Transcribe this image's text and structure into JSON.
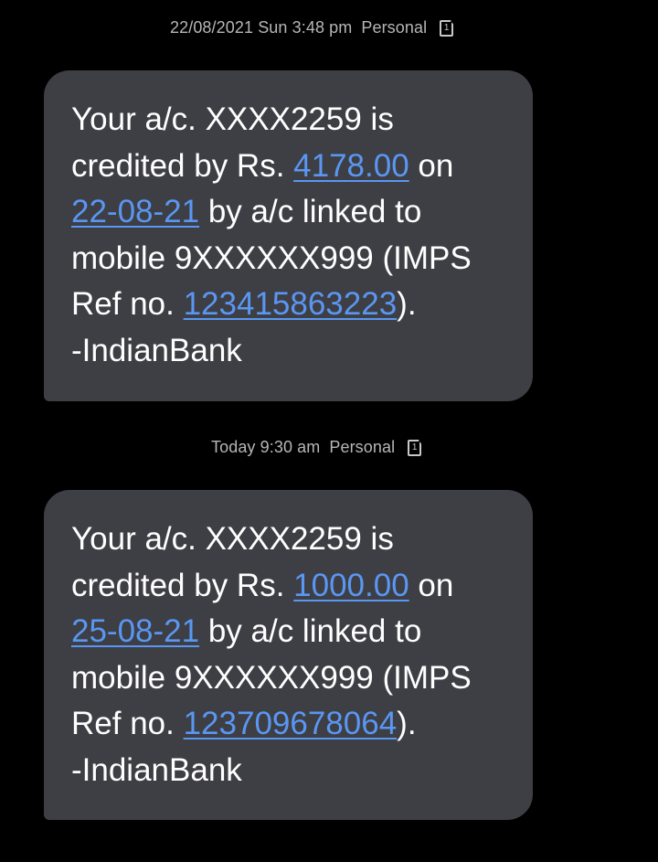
{
  "messages": [
    {
      "meta": {
        "timestamp": "22/08/2021 Sun 3:48 pm",
        "category": "Personal",
        "sim_label": "1"
      },
      "line1": "Your a/c. XXXX2259 is",
      "line2_prefix": "credited by Rs. ",
      "amount": "4178.00",
      "line2_suffix": " on",
      "date": "22-08-21",
      "line3_suffix": " by a/c linked to",
      "line4": "mobile 9XXXXXX999 (IMPS",
      "line5_prefix": "Ref no. ",
      "ref_no": "123415863223",
      "line5_suffix": ").",
      "line6": "-IndianBank"
    },
    {
      "meta": {
        "timestamp": "Today 9:30 am",
        "category": "Personal",
        "sim_label": "1"
      },
      "line1": "Your a/c. XXXX2259 is",
      "line2_prefix": "credited by Rs. ",
      "amount": "1000.00",
      "line2_suffix": " on",
      "date": "25-08-21",
      "line3_suffix": " by a/c linked to",
      "line4": "mobile 9XXXXXX999 (IMPS",
      "line5_prefix": "Ref no. ",
      "ref_no": "123709678064",
      "line5_suffix": ").",
      "line6": "-IndianBank"
    }
  ],
  "colors": {
    "background": "#000000",
    "bubble": "#3e3e45",
    "link": "#5a97f2",
    "meta_text": "#b6b6b8"
  },
  "icons": {
    "sim": "sim-card-icon"
  }
}
